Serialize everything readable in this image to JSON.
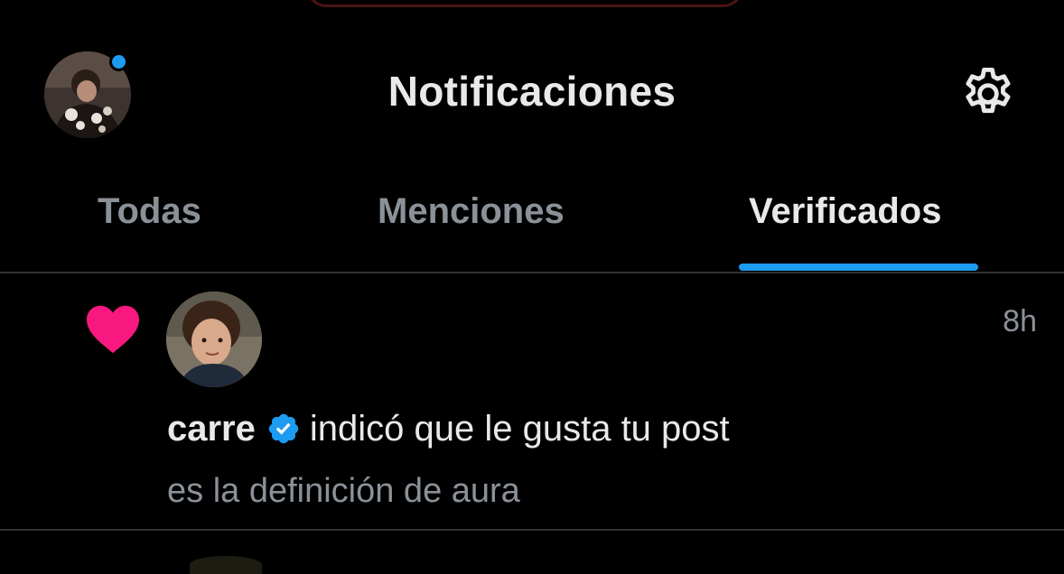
{
  "header": {
    "title": "Notificaciones",
    "settings_icon": "gear-icon",
    "avatar_badge_color": "#1d9bf0"
  },
  "tabs": [
    {
      "label": "Todas",
      "active": false
    },
    {
      "label": "Menciones",
      "active": false
    },
    {
      "label": "Verificados",
      "active": true
    }
  ],
  "accent_color": "#1d9bf0",
  "notifications": [
    {
      "icon": "heart-icon",
      "icon_color": "#f91880",
      "username": "carre",
      "verified": true,
      "action": "indicó que le gusta tu post",
      "preview": "es la definición de aura",
      "time": "8h"
    }
  ]
}
